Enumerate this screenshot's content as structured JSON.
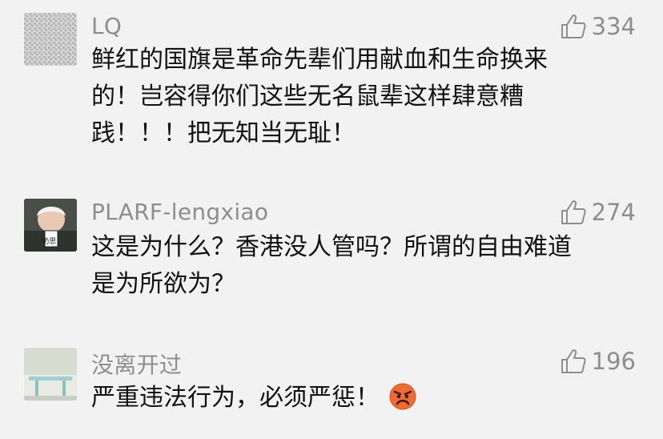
{
  "comments": [
    {
      "username": "LQ",
      "likes": "334",
      "text_lines": [
        "鲜红的国旗是革命先辈们用献血和生命换来",
        "的！岂容得你们这些无名鼠辈这样肆意糟",
        "践！！！把无知当无耻！"
      ],
      "avatar": "grey-texture-avatar"
    },
    {
      "username": "PLARF-lengxiao",
      "likes": "274",
      "text_lines": [
        "这是为什么？香港没人管吗？所谓的自由难道",
        "是为所欲为？"
      ],
      "avatar": "child-photo-avatar",
      "avatar_caption": "奶思!"
    },
    {
      "username": "没离开过",
      "likes": "196",
      "text_lines": [
        "严重违法行为，必须严惩！"
      ],
      "avatar": "room-photo-avatar",
      "emoji": "angry-face-icon"
    }
  ],
  "colors": {
    "background": "#f2f2f2",
    "username": "#8e8e8e",
    "body_text": "#111111",
    "emoji": "#e8652a"
  }
}
